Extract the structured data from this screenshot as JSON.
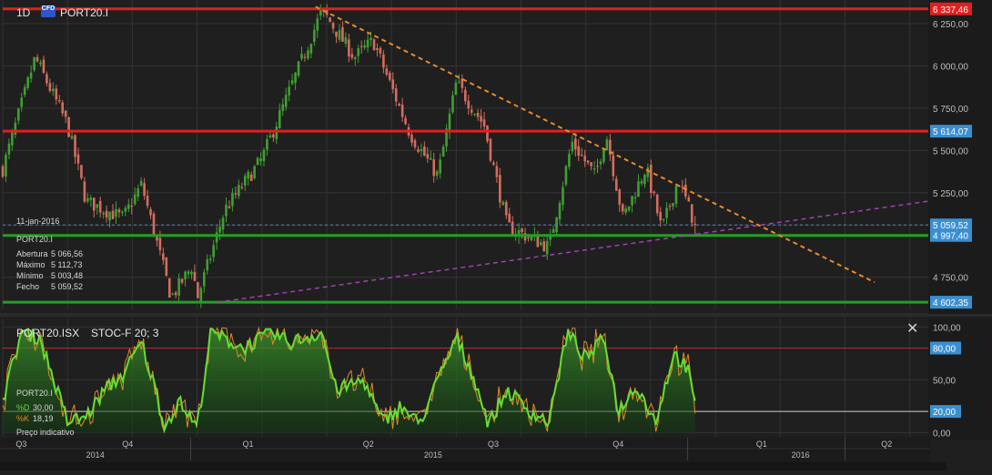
{
  "header": {
    "timeframe": "1D",
    "cfd_badge": "CFD",
    "symbol": "PORT20.I"
  },
  "info_panel": {
    "date": "11-jan-2016",
    "symbol": "PORT20.I",
    "rows": [
      {
        "label": "Abertura",
        "value": "5 066,56"
      },
      {
        "label": "Máximo",
        "value": "5 112,73"
      },
      {
        "label": "Mínimo",
        "value": "5 003,48"
      },
      {
        "label": "Fecho",
        "value": "5 059,52"
      }
    ]
  },
  "oscillator": {
    "title": "PORT20.ISX",
    "indicator": "STOC-F 20; 3",
    "symbol": "PORT20.I",
    "legend": [
      {
        "label": "%D",
        "value": "30,00",
        "color": "#66dd33"
      },
      {
        "label": "%K",
        "value": "18,19",
        "color": "#e08a2a"
      }
    ],
    "price_note": "Preço indicativo",
    "close_glyph": "✕"
  },
  "colors": {
    "background": "#1f1f1f",
    "grid": "#333333",
    "up_candle": "#3fa030",
    "down_candle": "#d46d5d",
    "resistance": "#e02020",
    "support": "#22a022",
    "trend_down": "#e68a30",
    "trend_up": "#a040b0",
    "price_tag": "#3a8fd0"
  },
  "chart_data": [
    {
      "type": "candlestick",
      "title": "PORT20.I",
      "ylim": [
        4560,
        6390
      ],
      "price_axis_ticks": [
        {
          "label": "6 337,46",
          "value": 6337.46
        },
        {
          "label": "6 250,00",
          "value": 6250
        },
        {
          "label": "6 000,00",
          "value": 6000
        },
        {
          "label": "5 750,00",
          "value": 5750
        },
        {
          "label": "5 614,07",
          "value": 5614.07
        },
        {
          "label": "5 500,00",
          "value": 5500
        },
        {
          "label": "5 250,00",
          "value": 5250
        },
        {
          "label": "5 059,52",
          "value": 5059.52
        },
        {
          "label": "4 997,40",
          "value": 4997.4
        },
        {
          "label": "4 750,00",
          "value": 4750
        },
        {
          "label": "4 602,35",
          "value": 4602.35
        }
      ],
      "horizontal_levels": [
        {
          "value": 6337.46,
          "kind": "resistance"
        },
        {
          "value": 5614.07,
          "kind": "resistance"
        },
        {
          "value": 4997.4,
          "kind": "support"
        },
        {
          "value": 4602.35,
          "kind": "support"
        },
        {
          "value": 5059.52,
          "kind": "last-close"
        }
      ],
      "trendlines": [
        {
          "kind": "descending",
          "from": {
            "t": 0.338,
            "v": 6350
          },
          "to": {
            "t": 0.942,
            "v": 4720
          }
        },
        {
          "kind": "ascending",
          "from": {
            "t": 0.232,
            "v": 4602
          },
          "to": {
            "t": 1.0,
            "v": 5200
          }
        }
      ],
      "anchors": [
        {
          "t": 0.0,
          "v": 5390
        },
        {
          "t": 0.035,
          "v": 6050
        },
        {
          "t": 0.07,
          "v": 5650
        },
        {
          "t": 0.09,
          "v": 5200
        },
        {
          "t": 0.13,
          "v": 5100
        },
        {
          "t": 0.15,
          "v": 5300
        },
        {
          "t": 0.182,
          "v": 4630
        },
        {
          "t": 0.205,
          "v": 4820
        },
        {
          "t": 0.21,
          "v": 4620
        },
        {
          "t": 0.24,
          "v": 5150
        },
        {
          "t": 0.28,
          "v": 5450
        },
        {
          "t": 0.345,
          "v": 6330
        },
        {
          "t": 0.38,
          "v": 6050
        },
        {
          "t": 0.4,
          "v": 6150
        },
        {
          "t": 0.44,
          "v": 5600
        },
        {
          "t": 0.47,
          "v": 5350
        },
        {
          "t": 0.49,
          "v": 5900
        },
        {
          "t": 0.52,
          "v": 5650
        },
        {
          "t": 0.545,
          "v": 5050
        },
        {
          "t": 0.59,
          "v": 4930
        },
        {
          "t": 0.615,
          "v": 5550
        },
        {
          "t": 0.64,
          "v": 5350
        },
        {
          "t": 0.652,
          "v": 5600
        },
        {
          "t": 0.67,
          "v": 5100
        },
        {
          "t": 0.695,
          "v": 5400
        },
        {
          "t": 0.712,
          "v": 5030
        },
        {
          "t": 0.73,
          "v": 5330
        },
        {
          "t": 0.748,
          "v": 5059.52
        }
      ],
      "last": {
        "open": 5066.56,
        "high": 5112.73,
        "low": 5003.48,
        "close": 5059.52
      }
    },
    {
      "type": "line",
      "title": "STOC-F 20; 3",
      "ylim": [
        -4,
        108
      ],
      "axis_ticks": [
        {
          "label": "100,00",
          "value": 100
        },
        {
          "label": "80,00",
          "value": 80
        },
        {
          "label": "50,00",
          "value": 50
        },
        {
          "label": "20,00",
          "value": 20
        },
        {
          "label": "0,00",
          "value": 0
        }
      ],
      "reference_lines": [
        80,
        20
      ],
      "series": [
        {
          "name": "%D",
          "last": 30.0
        },
        {
          "name": "%K",
          "last": 18.19
        }
      ],
      "anchors": [
        {
          "t": 0.0,
          "v": 30
        },
        {
          "t": 0.02,
          "v": 95
        },
        {
          "t": 0.04,
          "v": 90
        },
        {
          "t": 0.055,
          "v": 50
        },
        {
          "t": 0.07,
          "v": 10
        },
        {
          "t": 0.09,
          "v": 15
        },
        {
          "t": 0.11,
          "v": 40
        },
        {
          "t": 0.13,
          "v": 55
        },
        {
          "t": 0.15,
          "v": 85
        },
        {
          "t": 0.165,
          "v": 40
        },
        {
          "t": 0.175,
          "v": 5
        },
        {
          "t": 0.19,
          "v": 30
        },
        {
          "t": 0.21,
          "v": 5
        },
        {
          "t": 0.225,
          "v": 95
        },
        {
          "t": 0.26,
          "v": 80
        },
        {
          "t": 0.29,
          "v": 95
        },
        {
          "t": 0.31,
          "v": 85
        },
        {
          "t": 0.345,
          "v": 95
        },
        {
          "t": 0.36,
          "v": 40
        },
        {
          "t": 0.39,
          "v": 50
        },
        {
          "t": 0.41,
          "v": 10
        },
        {
          "t": 0.43,
          "v": 25
        },
        {
          "t": 0.45,
          "v": 8
        },
        {
          "t": 0.49,
          "v": 90
        },
        {
          "t": 0.51,
          "v": 50
        },
        {
          "t": 0.525,
          "v": 8
        },
        {
          "t": 0.545,
          "v": 40
        },
        {
          "t": 0.57,
          "v": 20
        },
        {
          "t": 0.59,
          "v": 10
        },
        {
          "t": 0.61,
          "v": 95
        },
        {
          "t": 0.63,
          "v": 70
        },
        {
          "t": 0.65,
          "v": 90
        },
        {
          "t": 0.665,
          "v": 20
        },
        {
          "t": 0.685,
          "v": 45
        },
        {
          "t": 0.705,
          "v": 10
        },
        {
          "t": 0.725,
          "v": 75
        },
        {
          "t": 0.74,
          "v": 60
        },
        {
          "t": 0.748,
          "v": 25
        }
      ]
    }
  ],
  "time_axis": {
    "quarters": [
      {
        "label": "Q3",
        "t": 0.02
      },
      {
        "label": "Q4",
        "t": 0.135
      },
      {
        "label": "Q1",
        "t": 0.265
      },
      {
        "label": "Q2",
        "t": 0.395
      },
      {
        "label": "Q3",
        "t": 0.53
      },
      {
        "label": "Q4",
        "t": 0.665
      },
      {
        "label": "Q1",
        "t": 0.82
      },
      {
        "label": "Q2",
        "t": 0.955
      }
    ],
    "years": [
      {
        "label": "2014",
        "t": 0.1
      },
      {
        "label": "2015",
        "t": 0.465
      },
      {
        "label": "2016",
        "t": 0.862
      }
    ],
    "dividers": [
      0.203,
      0.74,
      0.91
    ]
  }
}
